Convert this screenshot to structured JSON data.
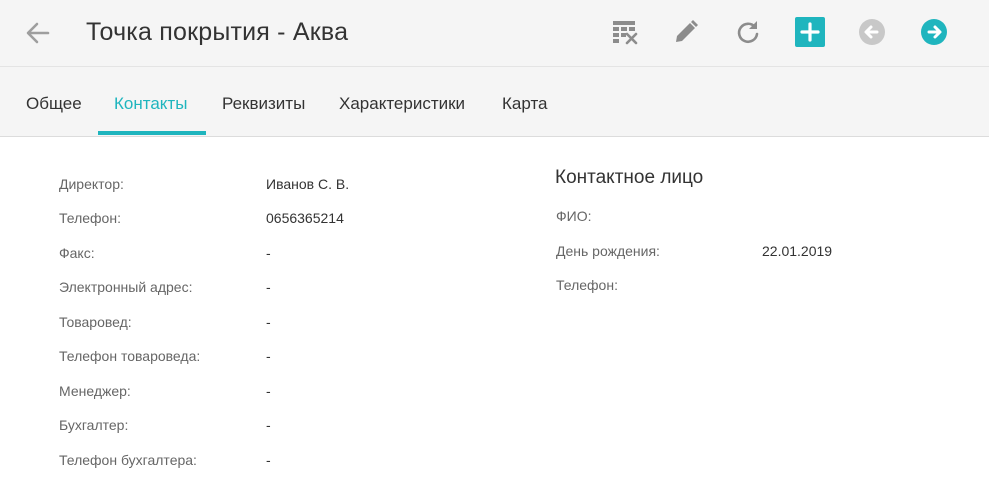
{
  "header": {
    "title": "Точка покрытия - Аква",
    "accent_color": "#1fb5be",
    "icons": [
      "back-arrow-icon",
      "table-delete-icon",
      "pencil-icon",
      "refresh-icon",
      "plus-icon",
      "arrow-left-circle-icon",
      "arrow-right-circle-icon"
    ]
  },
  "tabs": [
    {
      "label": "Общее"
    },
    {
      "label": "Контакты",
      "active": true
    },
    {
      "label": "Реквизиты"
    },
    {
      "label": "Характеристики"
    },
    {
      "label": "Карта"
    }
  ],
  "contacts": {
    "fields": [
      {
        "label": "Директор:",
        "value": "Иванов С. В."
      },
      {
        "label": "Телефон:",
        "value": "0656365214"
      },
      {
        "label": "Факс:",
        "value": "-"
      },
      {
        "label": "Электронный адрес:",
        "value": "-"
      },
      {
        "label": "Товаровед:",
        "value": "-"
      },
      {
        "label": "Телефон товароведа:",
        "value": "-"
      },
      {
        "label": "Менеджер:",
        "value": "-"
      },
      {
        "label": "Бухгалтер:",
        "value": "-"
      },
      {
        "label": "Телефон бухгалтера:",
        "value": "-"
      }
    ]
  },
  "contact_person": {
    "title": "Контактное лицо",
    "fields": [
      {
        "label": "ФИО:",
        "value": ""
      },
      {
        "label": "День рождения:",
        "value": "22.01.2019"
      },
      {
        "label": "Телефон:",
        "value": ""
      }
    ]
  }
}
